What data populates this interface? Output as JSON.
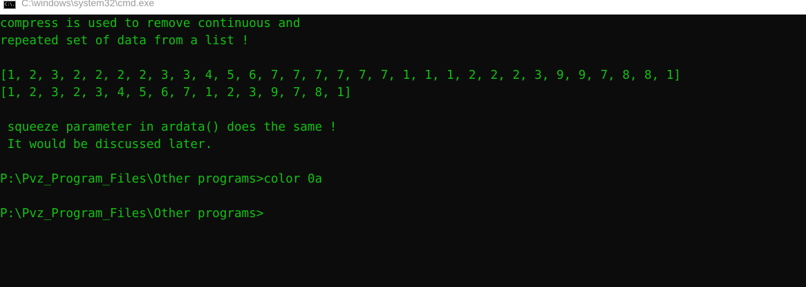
{
  "window": {
    "title": "C:\\windows\\system32\\cmd.exe",
    "icon": "cmd-console-icon",
    "icon_text": "C:\\."
  },
  "colors": {
    "background": "#0c0c0c",
    "text": "#13c113",
    "titlebar": "#ffffff",
    "title_text": "#9a9a9a"
  },
  "console": {
    "lines": [
      "compress is used to remove continuous and",
      "repeated set of data from a list !",
      "",
      "[1, 2, 3, 2, 2, 2, 2, 3, 3, 4, 5, 6, 7, 7, 7, 7, 7, 7, 1, 1, 1, 2, 2, 2, 3, 9, 9, 7, 8, 8, 1]",
      "[1, 2, 3, 2, 3, 4, 5, 6, 7, 1, 2, 3, 9, 7, 8, 1]",
      "",
      " squeeze parameter in ardata() does the same !",
      " It would be discussed later.",
      "",
      "P:\\Pvz_Program_Files\\Other programs>color 0a",
      "",
      "P:\\Pvz_Program_Files\\Other programs>"
    ]
  }
}
